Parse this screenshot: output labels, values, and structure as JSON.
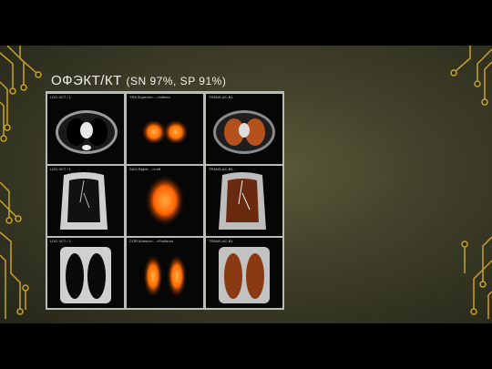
{
  "slide": {
    "title": "ОФЭКТ/КТ",
    "subtitle": "(SN 97%, SP 91%)"
  },
  "panels": [
    {
      "label": "LDG XCT / 1"
    },
    {
      "label": "TRA  Superior<- ->Inferior"
    },
    {
      "label": "TRANS-AC-B1"
    },
    {
      "label": "LDG XCT / 1"
    },
    {
      "label": "SAG  Right<- ->Left"
    },
    {
      "label": "TRANS-AC-B1"
    },
    {
      "label": "LDG XCT / 1"
    },
    {
      "label": "COR  Anterior<- ->Posterior"
    },
    {
      "label": "TRANS-AC-B1"
    }
  ],
  "colors": {
    "background": "#3f3f2a",
    "circuit": "#c9a227",
    "grid_border": "#b9bcb4",
    "spect_hot": "#ff8a1a",
    "ct_gray": "#d8d8d8"
  }
}
